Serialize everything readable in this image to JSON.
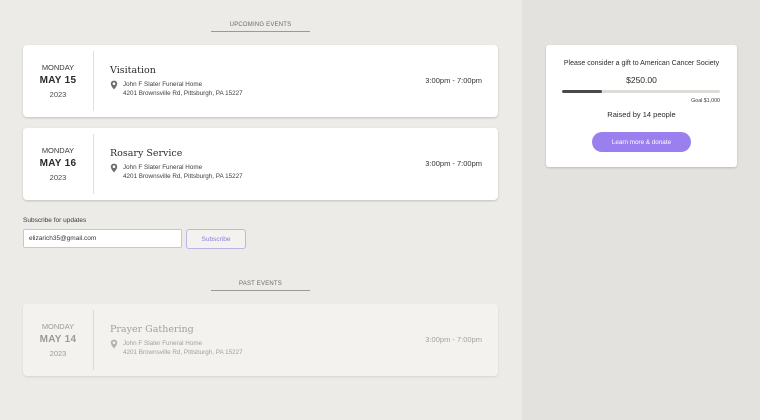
{
  "upcoming": {
    "heading": "UPCOMING EVENTS",
    "events": [
      {
        "weekday": "MONDAY",
        "month_day": "MAY 15",
        "year": "2023",
        "title": "Visitation",
        "venue": "John F Slater Funeral Home",
        "address": "4201 Brownsville Rd, Pittsburgh, PA 15227",
        "time": "3:00pm - 7:00pm"
      },
      {
        "weekday": "MONDAY",
        "month_day": "MAY 16",
        "year": "2023",
        "title": "Rosary Service",
        "venue": "John F Slater Funeral Home",
        "address": "4201 Brownsville Rd, Pittsburgh, PA 15227",
        "time": "3:00pm - 7:00pm"
      }
    ]
  },
  "subscribe": {
    "label": "Subscribe for updates",
    "email_value": "elizarich35@gmail.com",
    "button_label": "Subscribe"
  },
  "past": {
    "heading": "PAST EVENTS",
    "events": [
      {
        "weekday": "MONDAY",
        "month_day": "MAY 14",
        "year": "2023",
        "title": "Prayer Gathering",
        "venue": "John F Slater Funeral Home",
        "address": "4201 Brownsville Rd, Pittsburgh, PA 15227",
        "time": "3:00pm - 7:00pm"
      }
    ]
  },
  "donation": {
    "prompt": "Please consider a gift to American Cancer Society",
    "amount": "$250.00",
    "progress_fraction": 0.25,
    "goal_label": "Goal $1,000",
    "raised_label": "Raised by 14 people",
    "button_label": "Learn more & donate"
  },
  "icons": {
    "location": "location-pin-icon"
  },
  "colors": {
    "accent": "#9a80ef",
    "page_background": "#ecebe7",
    "sidebar_background": "#e3e2de",
    "progress_fill": "#4a4a4a"
  }
}
